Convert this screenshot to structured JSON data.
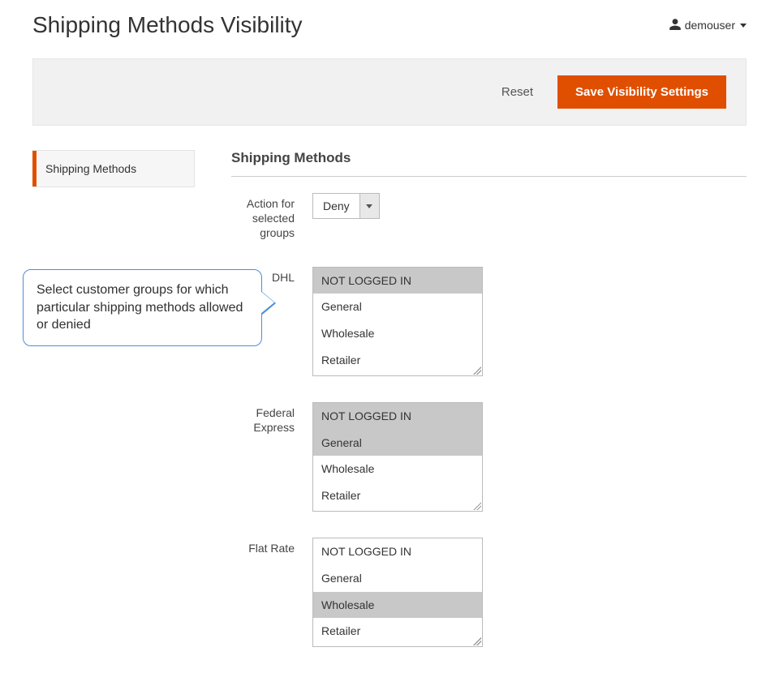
{
  "header": {
    "title": "Shipping Methods Visibility",
    "user": "demouser"
  },
  "actions": {
    "reset": "Reset",
    "save": "Save Visibility Settings"
  },
  "sidebar": {
    "tab_label": "Shipping Methods",
    "callout_text": "Select customer groups for which particular shipping methods allowed or denied"
  },
  "main": {
    "section_title": "Shipping Methods",
    "fields": {
      "action_label": "Action for selected groups",
      "action_value": "Deny",
      "dhl": {
        "label": "DHL",
        "options": [
          "NOT LOGGED IN",
          "General",
          "Wholesale",
          "Retailer"
        ],
        "selected": [
          0
        ]
      },
      "fedex": {
        "label": "Federal Express",
        "options": [
          "NOT LOGGED IN",
          "General",
          "Wholesale",
          "Retailer"
        ],
        "selected": [
          0,
          1
        ]
      },
      "flatrate": {
        "label": "Flat Rate",
        "options": [
          "NOT LOGGED IN",
          "General",
          "Wholesale",
          "Retailer"
        ],
        "selected": [
          2
        ]
      }
    }
  }
}
